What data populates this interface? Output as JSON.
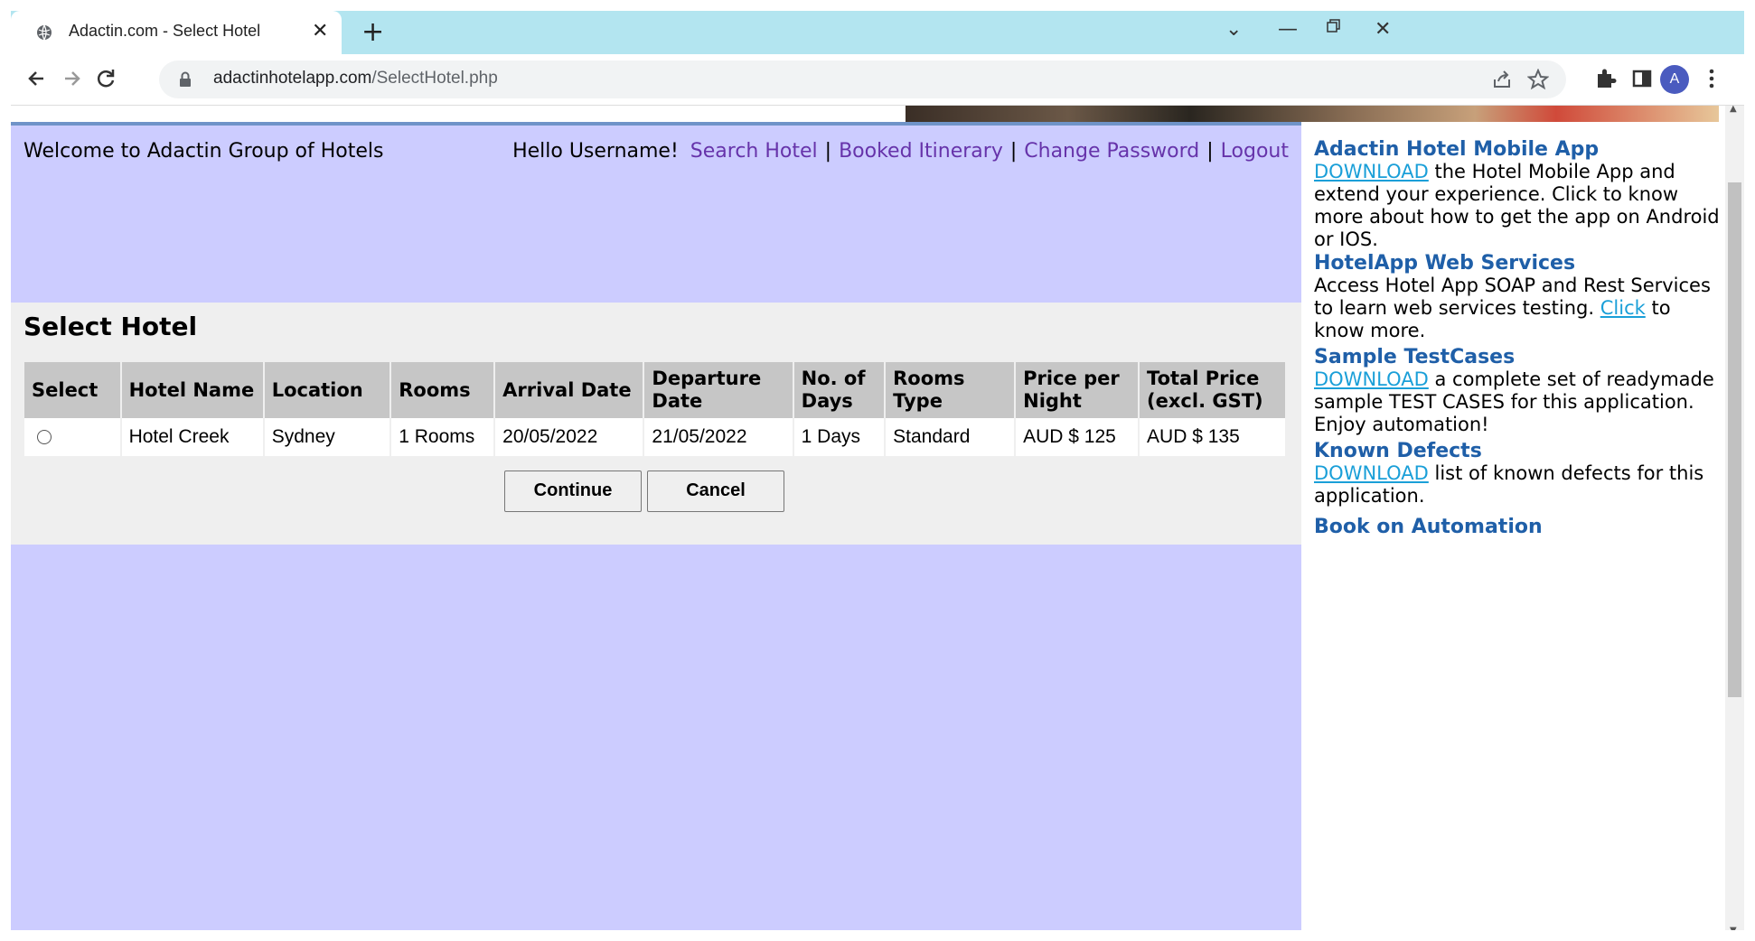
{
  "browser": {
    "tab_title": "Adactin.com - Select Hotel",
    "url_host": "adactinhotelapp.com",
    "url_path": "/SelectHotel.php",
    "avatar_letter": "A"
  },
  "header": {
    "welcome": "Welcome to Adactin Group of Hotels",
    "hello": "Hello Username!",
    "nav": [
      "Search Hotel",
      "Booked Itinerary",
      "Change Password",
      "Logout"
    ],
    "separator": "|"
  },
  "select_hotel": {
    "title": "Select Hotel",
    "columns": [
      "Select",
      "Hotel Name",
      "Location",
      "Rooms",
      "Arrival Date",
      "Departure Date",
      "No. of Days",
      "Rooms Type",
      "Price per Night",
      "Total Price (excl. GST)"
    ],
    "rows": [
      {
        "hotel_name": "Hotel Creek",
        "location": "Sydney",
        "rooms": "1 Rooms",
        "arrival": "20/05/2022",
        "departure": "21/05/2022",
        "days": "1 Days",
        "room_type": "Standard",
        "price_per_night": "AUD $ 125",
        "total_price": "AUD $ 135"
      }
    ],
    "continue_label": "Continue",
    "cancel_label": "Cancel"
  },
  "sidebar": {
    "mobile": {
      "title": "Adactin Hotel Mobile App",
      "link": "DOWNLOAD",
      "text": " the Hotel Mobile App and extend your experience. Click to know more about how to get the app on Android or IOS."
    },
    "webservices": {
      "title": "HotelApp Web Services",
      "text_before": "Access Hotel App SOAP and Rest Services to learn web services testing. ",
      "link": "Click",
      "text_after": " to know more."
    },
    "testcases": {
      "title": "Sample TestCases",
      "link": "DOWNLOAD",
      "text": " a complete set of readymade sample TEST CASES for this application. Enjoy automation!"
    },
    "defects": {
      "title": "Known Defects",
      "link": "DOWNLOAD",
      "text": " list of known defects for this application."
    },
    "book": {
      "title": "Book on Automation"
    }
  },
  "colors": {
    "tabstrip": "#b3e5f0",
    "main_bg": "#ccccff",
    "content_bg": "#efefef",
    "link_purple": "#6633aa",
    "sidebar_heading": "#1f5fa8",
    "download_link": "#1a9fd8"
  }
}
